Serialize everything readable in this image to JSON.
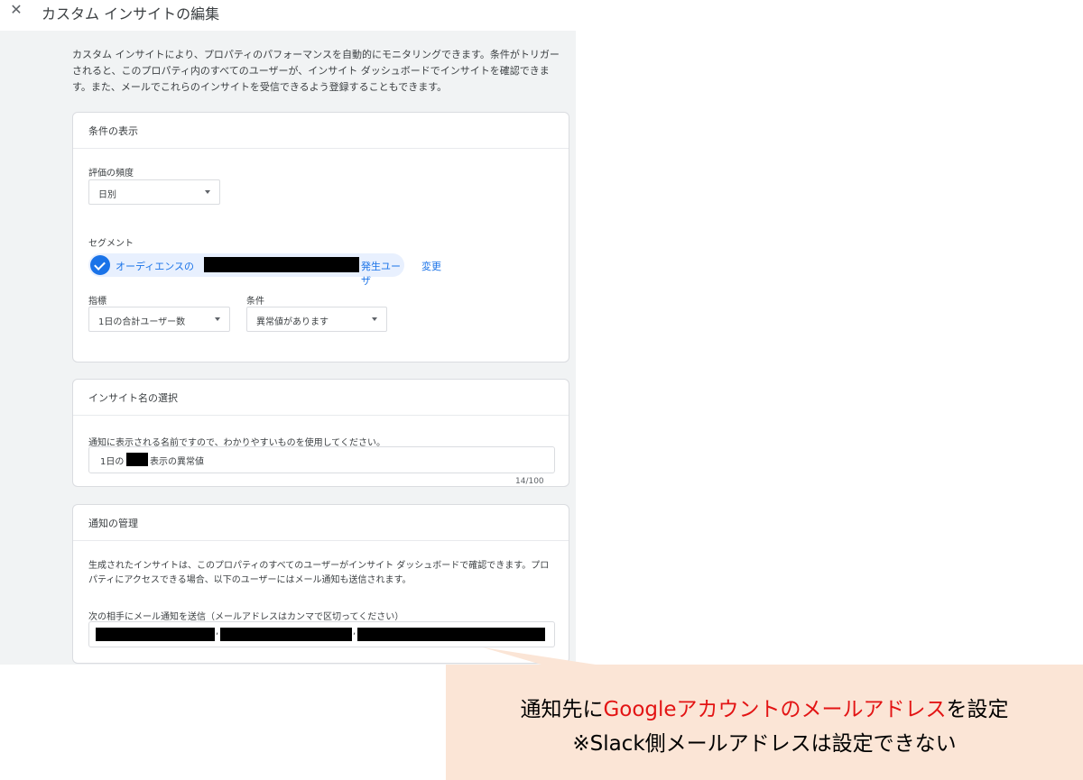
{
  "header": {
    "title": "カスタム インサイトの編集",
    "close_glyph": "✕"
  },
  "intro": {
    "text": "カスタム インサイトにより、プロパティのパフォーマンスを自動的にモニタリングできます。条件がトリガーされると、このプロパティ内のすべてのユーザーが、インサイト ダッシュボードでインサイトを確認できます。また、メールでこれらのインサイトを受信できるよう登録することもできます。"
  },
  "conditions": {
    "heading": "条件の表示",
    "frequency_label": "評価の頻度",
    "frequency_value": "日別",
    "segment_label": "セグメント",
    "segment_prefix": "オーディエンスの",
    "segment_suffix": "発生ユーザ",
    "change_link": "変更",
    "metric_label": "指標",
    "metric_value": "1日の合計ユーザー数",
    "condition_label": "条件",
    "condition_value": "異常値があります"
  },
  "insight_name": {
    "heading": "インサイト名の選択",
    "help": "通知に表示される名前ですので、わかりやすいものを使用してください。",
    "value_prefix": "1日の",
    "value_suffix": "表示の異常値",
    "counter": "14/100"
  },
  "notifications": {
    "heading": "通知の管理",
    "desc": "生成されたインサイトは、このプロパティのすべてのユーザーがインサイト ダッシュボードで確認できます。プロパティにアクセスできる場合、以下のユーザーにはメール通知も送信されます。",
    "email_label": "次の相手にメール通知を送信（メールアドレスはカンマで区切ってください）",
    "email_separator": ","
  },
  "callout": {
    "line1_prefix": "通知先に",
    "line1_highlight": "Googleアカウントのメールアドレス",
    "line1_suffix": "を設定",
    "line2": "※Slack側メールアドレスは設定できない"
  },
  "colors": {
    "accent": "#1a73e8",
    "panel_bg": "#f1f3f4",
    "callout_bg": "#fbe5d6",
    "callout_highlight": "#e31414"
  }
}
